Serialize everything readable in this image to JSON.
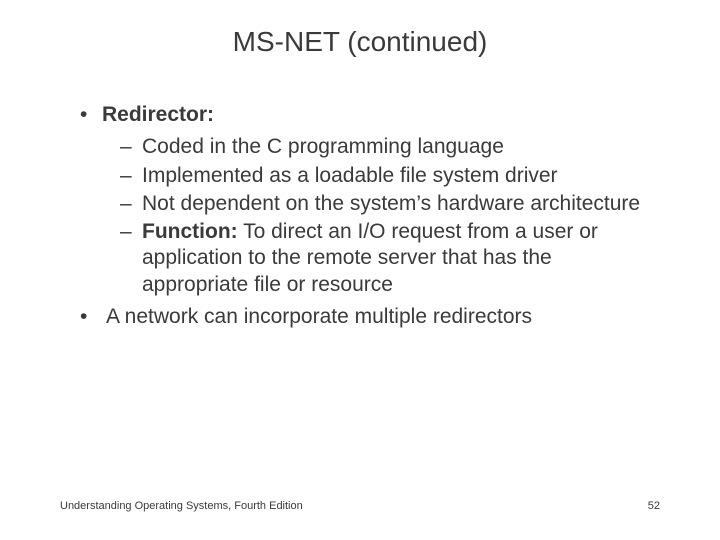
{
  "title": "MS-NET (continued)",
  "bullets": {
    "b1_label": "Redirector:",
    "sub1": "Coded in the C programming language",
    "sub2": "Implemented as a loadable file system driver",
    "sub3": "Not dependent on the system’s hardware architecture",
    "sub4_bold": "Function:",
    "sub4_rest": " To direct an I/O request from a user or application to the remote server that has the appropriate file or resource",
    "b2": "A network can incorporate multiple redirectors"
  },
  "footer": "Understanding Operating Systems, Fourth Edition",
  "page_number": "52"
}
